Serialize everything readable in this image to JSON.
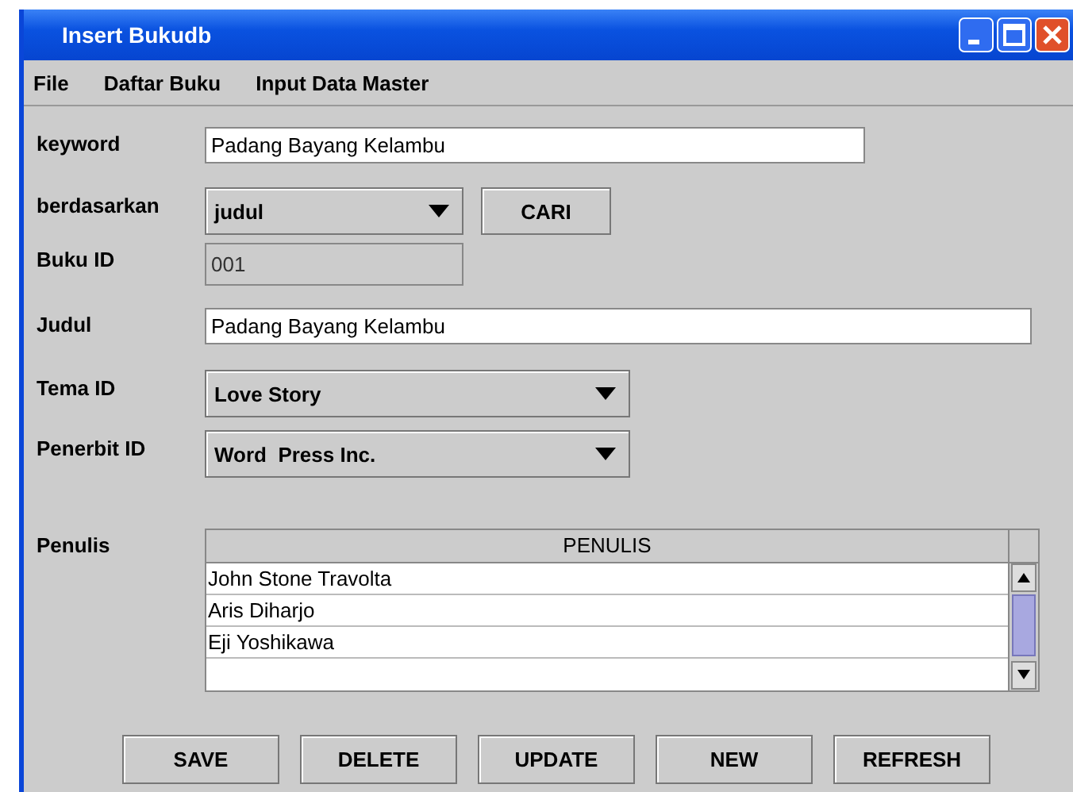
{
  "window": {
    "title": "Insert Bukudb"
  },
  "menu": [
    "File",
    "Daftar Buku",
    "Input Data Master"
  ],
  "keyword": {
    "label": "keyword",
    "value": "Padang Bayang Kelambu"
  },
  "berdasarkan": {
    "label": "berdasarkan",
    "value": "judul",
    "button": "CARI"
  },
  "buku_id": {
    "label": "Buku ID",
    "value": "001",
    "disabled": true
  },
  "judul": {
    "label": "Judul",
    "value": "Padang Bayang Kelambu"
  },
  "tema_id": {
    "label": "Tema ID",
    "value": "Love Story"
  },
  "penerbit_id": {
    "label": "Penerbit ID",
    "value": "Word  Press Inc."
  },
  "penulis": {
    "label": "Penulis",
    "column": "PENULIS",
    "rows": [
      "John Stone Travolta",
      "Aris Diharjo",
      "Eji Yoshikawa"
    ]
  },
  "buttons": [
    "SAVE",
    "DELETE",
    "UPDATE",
    "NEW",
    "REFRESH"
  ]
}
